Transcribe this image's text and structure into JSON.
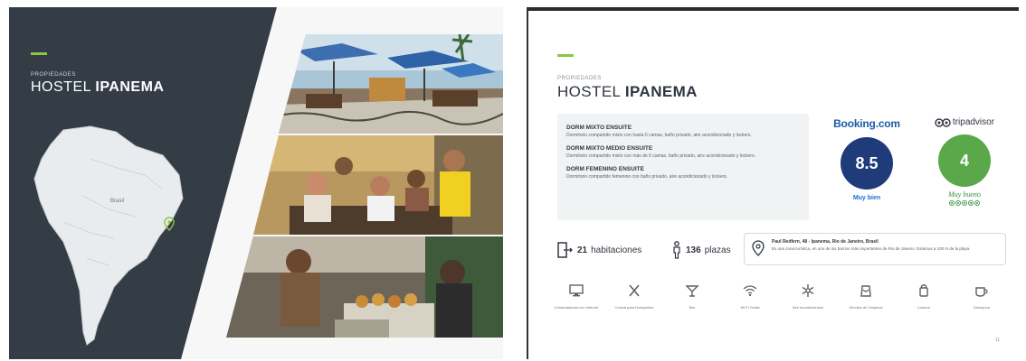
{
  "left_slide": {
    "kicker": "PROPIEDADES",
    "title_light": "HOSTEL",
    "title_bold": "IPANEMA",
    "map_label": "Brasil",
    "colors": {
      "panel": "#343d46",
      "accent": "#8dc63f"
    }
  },
  "right_slide": {
    "kicker": "PROPIEDADES",
    "title_light": "HOSTEL",
    "title_bold": "IPANEMA",
    "rooms": [
      {
        "name": "DORM MIXTO ENSUITE",
        "desc": "Dormitorio compartido mixto con hasta 6 camas, baño privado, aire acondicionado y lockers."
      },
      {
        "name": "DORM MIXTO MEDIO ENSUITE",
        "desc": "Dormitorio compartido mixto con más de 6 camas, baño privado, aire acondicionado y lockers."
      },
      {
        "name": "DORM FEMENINO ENSUITE",
        "desc": "Dormitorio compartido femenino con baño privado, aire acondicionado y lockers."
      }
    ],
    "booking": {
      "brand": "Booking.com",
      "score": "8.5",
      "verdict": "Muy bien"
    },
    "tripadvisor": {
      "brand": "tripadvisor",
      "score": "4",
      "verdict": "Muy bueno",
      "rating_dots": 5
    },
    "stats": {
      "rooms_num": "21",
      "rooms_label": "habitaciones",
      "beds_num": "136",
      "beds_label": "plazas"
    },
    "address": {
      "main": "Paul Redfern, 48 - Ipanema, Rio de Janeiro, Brasil",
      "sub": "Es una zona turística, en uno de los barrios más importantes de Rio de Janeiro. Estamos a 100 m de la playa."
    },
    "amenities": [
      {
        "icon": "computer-icon",
        "label": "Computadoras con Internet"
      },
      {
        "icon": "kitchen-icon",
        "label": "Cocina para Huéspedes"
      },
      {
        "icon": "bar-icon",
        "label": "Bar"
      },
      {
        "icon": "wifi-icon",
        "label": "Wi-Fi Gratis"
      },
      {
        "icon": "ac-icon",
        "label": "Aire Acondicionado"
      },
      {
        "icon": "laundry-icon",
        "label": "Servicio de Limpieza"
      },
      {
        "icon": "locker-icon",
        "label": "Lockers"
      },
      {
        "icon": "breakfast-icon",
        "label": "Desayuno"
      }
    ],
    "page_number": "11",
    "colors": {
      "booking_circle": "#1f3b7a",
      "trip_circle": "#5aa84a",
      "booking_brand": "#1d5aa8"
    }
  }
}
